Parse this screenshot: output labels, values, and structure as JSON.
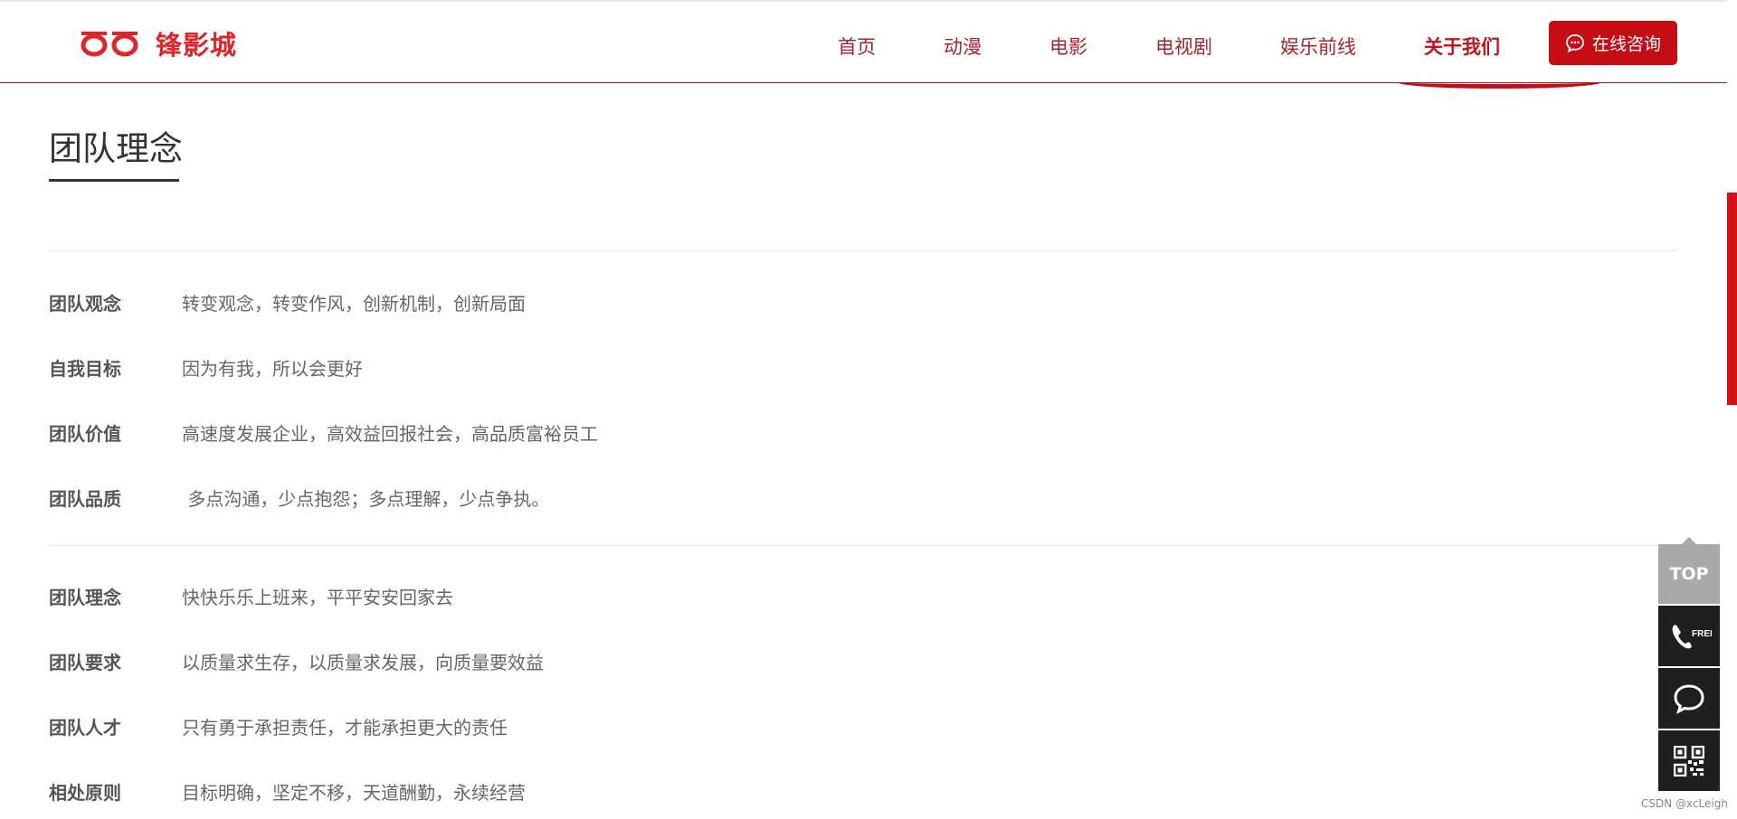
{
  "header": {
    "logo_text": "锋影城",
    "nav": [
      {
        "label": "首页",
        "active": false
      },
      {
        "label": "动漫",
        "active": false
      },
      {
        "label": "电影",
        "active": false
      },
      {
        "label": "电视剧",
        "active": false
      },
      {
        "label": "娱乐前线",
        "active": false
      },
      {
        "label": "关于我们",
        "active": true
      }
    ],
    "consult_label": "在线咨询"
  },
  "section": {
    "title": "团队理念",
    "group1": [
      {
        "label": "团队观念",
        "value": "转变观念，转变作风，创新机制，创新局面"
      },
      {
        "label": "自我目标",
        "value": "因为有我，所以会更好"
      },
      {
        "label": "团队价值",
        "value": "高速度发展企业，高效益回报社会，高品质富裕员工"
      },
      {
        "label": "团队品质",
        "value": " 多点沟通，少点抱怨；多点理解，少点争执。"
      }
    ],
    "group2": [
      {
        "label": "团队理念",
        "value": "快快乐乐上班来，平平安安回家去"
      },
      {
        "label": "团队要求",
        "value": "以质量求生存，以质量求发展，向质量要效益"
      },
      {
        "label": "团队人才",
        "value": "只有勇于承担责任，才能承担更大的责任"
      },
      {
        "label": "相处原则",
        "value": "目标明确，坚定不移，天道酬勤，永续经营"
      }
    ]
  },
  "float_bar": {
    "top_label": "TOP",
    "free_label": "FREE"
  },
  "watermark": "CSDN @xcLeigh",
  "colors": {
    "brand_red": "#c40e14",
    "nav_red": "#a3262b",
    "float_dark": "#1f1f1f",
    "float_gray": "#a9a9a9"
  }
}
